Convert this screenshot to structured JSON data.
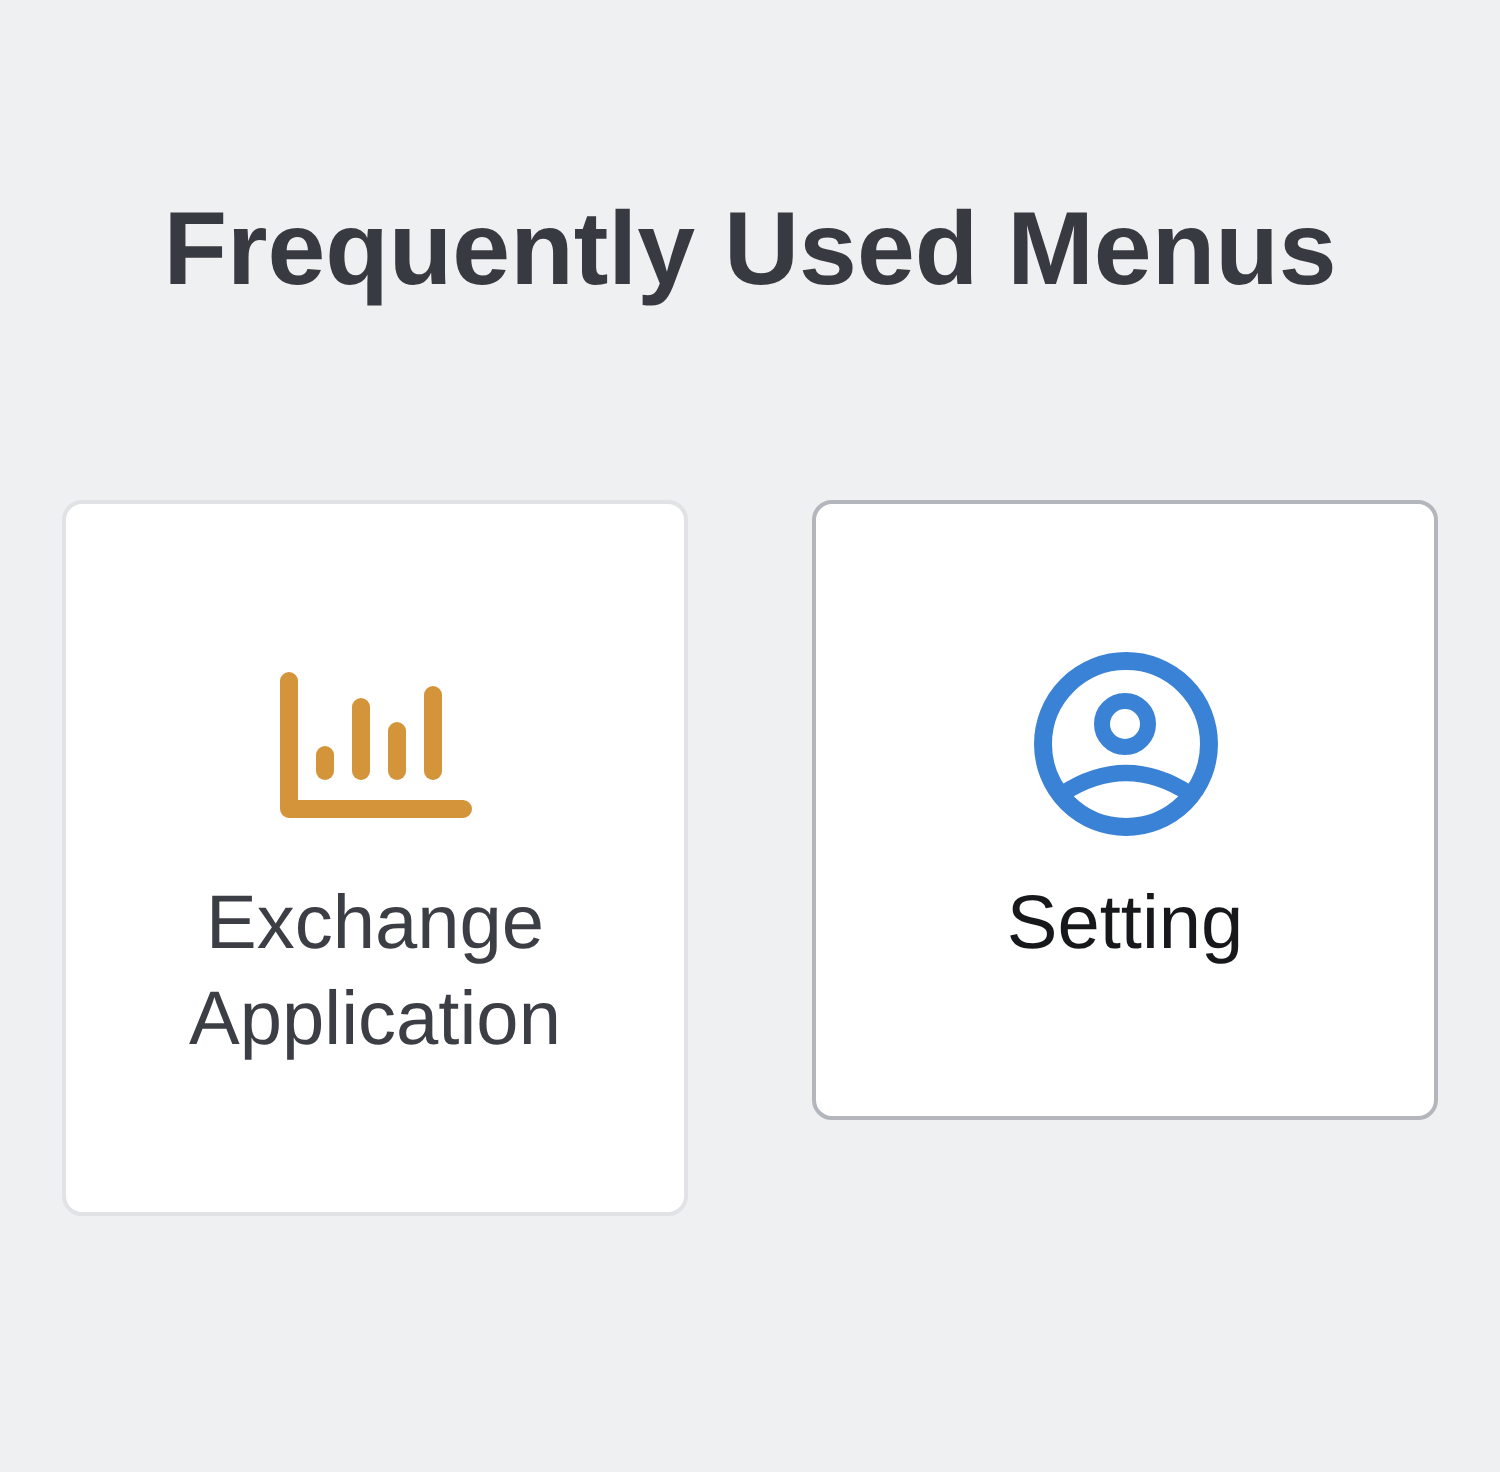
{
  "title": "Frequently Used Menus",
  "menus": [
    {
      "label": "Exchange Application",
      "kind": "chart",
      "color": "#d4943a",
      "selected": false
    },
    {
      "label": "Setting",
      "kind": "user",
      "color": "#3a82d6",
      "selected": true
    }
  ]
}
